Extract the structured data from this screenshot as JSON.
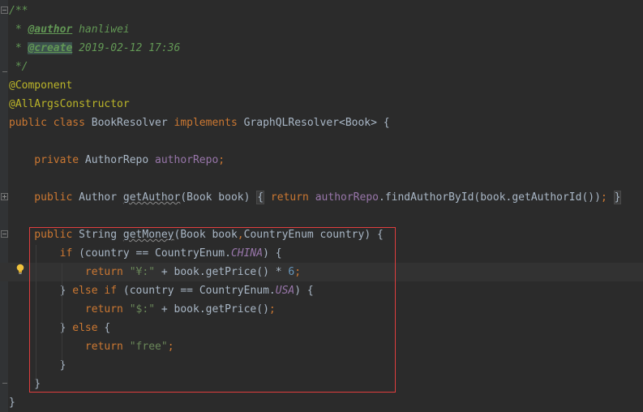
{
  "editor": {
    "lines": [
      [
        {
          "t": "/**",
          "c": "c-comment"
        }
      ],
      [
        {
          "t": " * ",
          "c": "c-comment"
        },
        {
          "t": "@author",
          "c": "c-tag"
        },
        {
          "t": " hanliwei",
          "c": "c-comment"
        }
      ],
      [
        {
          "t": " * ",
          "c": "c-comment"
        },
        {
          "t": "@create",
          "c": "c-tag c-tag-hl"
        },
        {
          "t": " 2019-02-12 17:36",
          "c": "c-comment"
        }
      ],
      [
        {
          "t": " */",
          "c": "c-comment"
        }
      ],
      [
        {
          "t": "@Component",
          "c": "c-annot"
        }
      ],
      [
        {
          "t": "@AllArgsConstructor",
          "c": "c-annot"
        }
      ],
      [
        {
          "t": "public class ",
          "c": "c-kw"
        },
        {
          "t": "BookResolver ",
          "c": "c-id"
        },
        {
          "t": "implements ",
          "c": "c-kw"
        },
        {
          "t": "GraphQLResolver<Book> {",
          "c": "c-id"
        }
      ],
      [],
      [
        {
          "t": "    private ",
          "c": "c-kw"
        },
        {
          "t": "AuthorRepo ",
          "c": "c-id"
        },
        {
          "t": "authorRepo",
          "c": "c-field"
        },
        {
          "t": ";",
          "c": "c-kw"
        }
      ],
      [],
      [
        {
          "t": "    public ",
          "c": "c-kw"
        },
        {
          "t": "Author ",
          "c": "c-id"
        },
        {
          "t": "getAuthor",
          "c": "c-id c-warn"
        },
        {
          "t": "(Book book) ",
          "c": "c-id"
        },
        {
          "t": "{",
          "c": "c-id c-fold"
        },
        {
          "t": " ",
          "c": "c-id"
        },
        {
          "t": "return ",
          "c": "c-kw"
        },
        {
          "t": "authorRepo",
          "c": "c-field"
        },
        {
          "t": ".findAuthorById(book.getAuthorId())",
          "c": "c-id"
        },
        {
          "t": ";",
          "c": "c-kw"
        },
        {
          "t": " ",
          "c": "c-id"
        },
        {
          "t": "}",
          "c": "c-id c-fold"
        }
      ],
      [],
      [
        {
          "t": "    public ",
          "c": "c-kw"
        },
        {
          "t": "String ",
          "c": "c-id"
        },
        {
          "t": "getMoney",
          "c": "c-id c-warn"
        },
        {
          "t": "(Book book",
          "c": "c-id"
        },
        {
          "t": ",",
          "c": "c-kw"
        },
        {
          "t": "CountryEnum country) {",
          "c": "c-id"
        }
      ],
      [
        {
          "t": "        if ",
          "c": "c-kw"
        },
        {
          "t": "(country == CountryEnum.",
          "c": "c-id"
        },
        {
          "t": "CHINA",
          "c": "c-const"
        },
        {
          "t": ") {",
          "c": "c-id"
        }
      ],
      [
        {
          "t": "            return ",
          "c": "c-kw"
        },
        {
          "t": "\"¥:\"",
          "c": "c-str"
        },
        {
          "t": " + book.getPrice() * ",
          "c": "c-id"
        },
        {
          "t": "6",
          "c": "c-num"
        },
        {
          "t": ";",
          "c": "c-kw"
        }
      ],
      [
        {
          "t": "        } ",
          "c": "c-id"
        },
        {
          "t": "else if ",
          "c": "c-kw"
        },
        {
          "t": "(country == CountryEnum.",
          "c": "c-id"
        },
        {
          "t": "USA",
          "c": "c-const"
        },
        {
          "t": ") {",
          "c": "c-id"
        }
      ],
      [
        {
          "t": "            return ",
          "c": "c-kw"
        },
        {
          "t": "\"$:\"",
          "c": "c-str"
        },
        {
          "t": " + book.getPrice()",
          "c": "c-id"
        },
        {
          "t": ";",
          "c": "c-kw"
        }
      ],
      [
        {
          "t": "        } ",
          "c": "c-id"
        },
        {
          "t": "else ",
          "c": "c-kw"
        },
        {
          "t": "{",
          "c": "c-id"
        }
      ],
      [
        {
          "t": "            return ",
          "c": "c-kw"
        },
        {
          "t": "\"free\"",
          "c": "c-str"
        },
        {
          "t": ";",
          "c": "c-kw"
        }
      ],
      [
        {
          "t": "        }",
          "c": "c-id"
        }
      ],
      [
        {
          "t": "    }",
          "c": "c-id"
        }
      ],
      [
        {
          "t": "}",
          "c": "c-id"
        }
      ]
    ]
  },
  "icons": {
    "bulb": "lightbulb-icon",
    "fold": "fold-marker-icon"
  },
  "colors": {
    "background": "#2b2b2b",
    "keyword": "#cc7832",
    "comment": "#629755",
    "annotation": "#bbb529",
    "field": "#9876aa",
    "string": "#6a8759",
    "number": "#6897bb",
    "highlight_box": "#e03e3e"
  }
}
